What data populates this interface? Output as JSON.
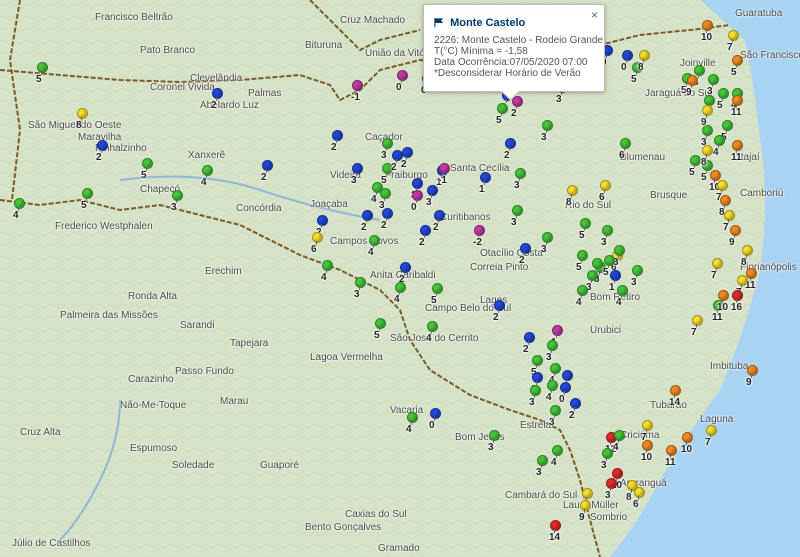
{
  "colors": {
    "green": "#46c43a",
    "blue": "#2347d9",
    "purple": "#c23aa5",
    "yellow": "#f5dd2c",
    "orange": "#f08a23",
    "red": "#e02a2a",
    "border": "#7a5a28",
    "sea": "#a9d3f3"
  },
  "popup": {
    "title": "Monte Castelo",
    "station": "2226: Monte Castelo - Rodeio Grande",
    "temp": "T(°C) Mínima = -1,58",
    "date": "Data Ocorrência:07/05/2020 07:00",
    "note": "*Desconsiderar Horário de Verão",
    "close": "×"
  },
  "places": [
    {
      "n": "Francisco Beltrão"
    },
    {
      "n": "Pato Branco"
    },
    {
      "n": "Clevelândia"
    },
    {
      "n": "Palmas"
    },
    {
      "n": "Abelardo Luz"
    },
    {
      "n": "Coronel Vivida"
    },
    {
      "n": "Cruz Machado"
    },
    {
      "n": "Bituruna"
    },
    {
      "n": "União da Vitória"
    },
    {
      "n": "Guaratuba"
    },
    {
      "n": "Joinville"
    },
    {
      "n": "São Francisco do Sul"
    },
    {
      "n": "Jaraguá do Sul"
    },
    {
      "n": "Itajaí"
    },
    {
      "n": "Blumenau"
    },
    {
      "n": "Camboriú"
    },
    {
      "n": "Brusque"
    },
    {
      "n": "Rio do Sul"
    },
    {
      "n": "Florianópolis"
    },
    {
      "n": "São Miguel do Oeste"
    },
    {
      "n": "Maravilha"
    },
    {
      "n": "Pinhalzinho"
    },
    {
      "n": "Xanxerê"
    },
    {
      "n": "Chapecó"
    },
    {
      "n": "Concórdia"
    },
    {
      "n": "Caçador"
    },
    {
      "n": "Videira"
    },
    {
      "n": "Fraiburgo"
    },
    {
      "n": "Curitibanos"
    },
    {
      "n": "Santa Cecília"
    },
    {
      "n": "Campos Novos"
    },
    {
      "n": "Anita Garibaldi"
    },
    {
      "n": "Joaçaba"
    },
    {
      "n": "Lages"
    },
    {
      "n": "Otacílio Costa"
    },
    {
      "n": "Correia Pinto"
    },
    {
      "n": "Bom Retiro"
    },
    {
      "n": "Urubici"
    },
    {
      "n": "Campo Belo do Sul"
    },
    {
      "n": "São José do Cerrito"
    },
    {
      "n": "Tubarão"
    },
    {
      "n": "Laguna"
    },
    {
      "n": "Criciúma"
    },
    {
      "n": "Araranguá"
    },
    {
      "n": "Imbituba"
    },
    {
      "n": "Frederico Westphalen"
    },
    {
      "n": "Erechim"
    },
    {
      "n": "Ronda Alta"
    },
    {
      "n": "Palmeira das Missões"
    },
    {
      "n": "Sarandi"
    },
    {
      "n": "Tapejara"
    },
    {
      "n": "Lagoa Vermelha"
    },
    {
      "n": "Carazinho"
    },
    {
      "n": "Passo Fundo"
    },
    {
      "n": "Marau"
    },
    {
      "n": "Não-Me-Toque"
    },
    {
      "n": "Espumoso"
    },
    {
      "n": "Cruz Alta"
    },
    {
      "n": "Soledade"
    },
    {
      "n": "Guaporé"
    },
    {
      "n": "Vacaria"
    },
    {
      "n": "Bom Jesus"
    },
    {
      "n": "Cambará do Sul"
    },
    {
      "n": "Caxias do Sul"
    },
    {
      "n": "Bento Gonçalves"
    },
    {
      "n": "Gramado"
    },
    {
      "n": "Júlio de Castilhos"
    },
    {
      "n": "Sombrio"
    },
    {
      "n": "Estrela"
    },
    {
      "n": "Lauro Müller"
    }
  ],
  "markers": [
    {
      "c": "green",
      "v": "5"
    },
    {
      "c": "purple",
      "v": "0"
    },
    {
      "c": "purple",
      "v": "-1"
    },
    {
      "c": "purple",
      "v": "0"
    },
    {
      "c": "blue",
      "v": "2"
    },
    {
      "c": "yellow",
      "v": "8"
    },
    {
      "c": "blue",
      "v": "2"
    },
    {
      "c": "green",
      "v": "5"
    },
    {
      "c": "green",
      "v": "4"
    },
    {
      "c": "blue",
      "v": "2"
    },
    {
      "c": "green",
      "v": "3"
    },
    {
      "c": "green",
      "v": "5"
    },
    {
      "c": "green",
      "v": "5"
    },
    {
      "c": "green",
      "v": "4"
    },
    {
      "c": "green",
      "v": "3"
    },
    {
      "c": "blue",
      "v": "2"
    },
    {
      "c": "blue",
      "v": "3"
    },
    {
      "c": "blue",
      "v": "2"
    },
    {
      "c": "blue",
      "v": "3"
    },
    {
      "c": "blue",
      "v": "1"
    },
    {
      "c": "blue",
      "v": "2"
    },
    {
      "c": "blue",
      "v": "3"
    },
    {
      "c": "purple",
      "v": "-1"
    },
    {
      "c": "blue",
      "v": "1"
    },
    {
      "c": "green",
      "v": "3"
    },
    {
      "c": "blue",
      "v": "2"
    },
    {
      "c": "green",
      "v": "4"
    },
    {
      "c": "green",
      "v": "3"
    },
    {
      "c": "purple",
      "v": "0"
    },
    {
      "c": "blue",
      "v": "2"
    },
    {
      "c": "blue",
      "v": "2"
    },
    {
      "c": "blue",
      "v": "2"
    },
    {
      "c": "blue",
      "v": "2"
    },
    {
      "c": "purple",
      "v": "-2"
    },
    {
      "c": "green",
      "v": "3"
    },
    {
      "c": "yellow",
      "v": "6"
    },
    {
      "c": "green",
      "v": "4"
    },
    {
      "c": "blue",
      "v": "2"
    },
    {
      "c": "green",
      "v": "4"
    },
    {
      "c": "green",
      "v": "3"
    },
    {
      "c": "blue",
      "v": "2"
    },
    {
      "c": "green",
      "v": "4"
    },
    {
      "c": "green",
      "v": "5"
    },
    {
      "c": "green",
      "v": "3"
    },
    {
      "c": "green",
      "v": "3"
    },
    {
      "c": "blue",
      "v": "0"
    },
    {
      "c": "blue",
      "v": "0"
    },
    {
      "c": "green",
      "v": "5"
    },
    {
      "c": "blue",
      "v": "0"
    },
    {
      "c": "green",
      "v": "3"
    },
    {
      "c": "purple",
      "v": "2"
    },
    {
      "c": "green",
      "v": "5"
    },
    {
      "c": "blue",
      "v": "2"
    },
    {
      "c": "green",
      "v": "3"
    },
    {
      "c": "green",
      "v": "6"
    },
    {
      "c": "yellow",
      "v": "6"
    },
    {
      "c": "yellow",
      "v": "8"
    },
    {
      "c": "green",
      "v": "5"
    },
    {
      "c": "green",
      "v": "3"
    },
    {
      "c": "yellow",
      "v": "6"
    },
    {
      "c": "green",
      "v": "3"
    },
    {
      "c": "green",
      "v": "3"
    },
    {
      "c": "green",
      "v": "5"
    },
    {
      "c": "green",
      "v": "5"
    },
    {
      "c": "blue",
      "v": "1"
    },
    {
      "c": "green",
      "v": "3"
    },
    {
      "c": "green",
      "v": "4"
    },
    {
      "c": "green",
      "v": "4"
    },
    {
      "c": "purple",
      "v": "1"
    },
    {
      "c": "green",
      "v": "3"
    },
    {
      "c": "blue",
      "v": "2"
    },
    {
      "c": "green",
      "v": "5"
    },
    {
      "c": "blue",
      "v": "3"
    },
    {
      "c": "green",
      "v": "4"
    },
    {
      "c": "green",
      "v": "4"
    },
    {
      "c": "blue",
      "v": "2"
    },
    {
      "c": "blue",
      "v": "0"
    },
    {
      "c": "green",
      "v": "3"
    },
    {
      "c": "blue",
      "v": "2"
    },
    {
      "c": "green",
      "v": "3"
    },
    {
      "c": "yellow",
      "v": "8"
    },
    {
      "c": "green",
      "v": "5"
    },
    {
      "c": "green",
      "v": "4"
    },
    {
      "c": "green",
      "v": "3"
    },
    {
      "c": "green",
      "v": "5"
    },
    {
      "c": "green",
      "v": "4"
    },
    {
      "c": "green",
      "v": "4"
    },
    {
      "c": "green",
      "v": "5"
    },
    {
      "c": "green",
      "v": "3"
    },
    {
      "c": "green",
      "v": "4"
    },
    {
      "c": "green",
      "v": "5"
    },
    {
      "c": "green",
      "v": "5"
    },
    {
      "c": "blue",
      "v": "0"
    },
    {
      "c": "orange",
      "v": "10"
    },
    {
      "c": "yellow",
      "v": "7"
    },
    {
      "c": "orange",
      "v": "5"
    },
    {
      "c": "orange",
      "v": "9"
    },
    {
      "c": "orange",
      "v": "11"
    },
    {
      "c": "yellow",
      "v": "9"
    },
    {
      "c": "orange",
      "v": "11"
    },
    {
      "c": "yellow",
      "v": "8"
    },
    {
      "c": "orange",
      "v": "10"
    },
    {
      "c": "yellow",
      "v": "7"
    },
    {
      "c": "orange",
      "v": "8"
    },
    {
      "c": "yellow",
      "v": "7"
    },
    {
      "c": "orange",
      "v": "9"
    },
    {
      "c": "yellow",
      "v": "8"
    },
    {
      "c": "yellow",
      "v": "7"
    },
    {
      "c": "orange",
      "v": "11"
    },
    {
      "c": "yellow",
      "v": "7"
    },
    {
      "c": "green",
      "v": "11"
    },
    {
      "c": "orange",
      "v": "10"
    },
    {
      "c": "yellow",
      "v": "7"
    },
    {
      "c": "red",
      "v": "16"
    },
    {
      "c": "orange",
      "v": "9"
    },
    {
      "c": "orange",
      "v": "14"
    },
    {
      "c": "yellow",
      "v": "7"
    },
    {
      "c": "red",
      "v": "12"
    },
    {
      "c": "orange",
      "v": "10"
    },
    {
      "c": "yellow",
      "v": "7"
    },
    {
      "c": "orange",
      "v": "10"
    },
    {
      "c": "orange",
      "v": "11"
    },
    {
      "c": "red",
      "v": "10"
    },
    {
      "c": "red",
      "v": "3"
    },
    {
      "c": "yellow",
      "v": "8"
    },
    {
      "c": "yellow",
      "v": "9"
    },
    {
      "c": "red",
      "v": "14"
    },
    {
      "c": "yellow",
      "v": "8"
    },
    {
      "c": "yellow",
      "v": "6"
    },
    {
      "c": "green",
      "v": "4"
    },
    {
      "c": "green",
      "v": "3"
    },
    {
      "c": "green",
      "v": "4"
    },
    {
      "c": "green",
      "v": "3"
    },
    {
      "c": "green",
      "v": "5"
    },
    {
      "c": "green",
      "v": "4"
    },
    {
      "c": "green",
      "v": "3"
    },
    {
      "c": "green",
      "v": "5"
    },
    {
      "c": "green",
      "v": "4"
    },
    {
      "c": "blue",
      "v": "2"
    }
  ]
}
